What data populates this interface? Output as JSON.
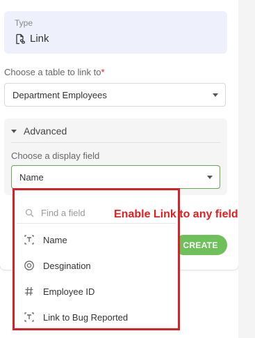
{
  "type_field": {
    "label": "Type",
    "value": "Link",
    "icon": "link-file-icon"
  },
  "table_field": {
    "label": "Choose a table to link to",
    "required_mark": "*",
    "value": "Department Employees"
  },
  "advanced": {
    "label": "Advanced",
    "display_field_label": "Choose a display field",
    "display_field_value": "Name"
  },
  "dropdown": {
    "search_placeholder": "Find a field",
    "options": [
      {
        "label": "Name",
        "icon": "text-field-icon"
      },
      {
        "label": "Desgination",
        "icon": "single-select-icon"
      },
      {
        "label": "Employee ID",
        "icon": "number-field-icon"
      },
      {
        "label": "Link to Bug Reported",
        "icon": "text-field-icon"
      }
    ]
  },
  "create_button": {
    "label": "CREATE"
  },
  "annotation": {
    "text": "Enable Link to any field"
  },
  "colors": {
    "type_box_bg": "#eef0fb",
    "create_button": "#6dc05a",
    "focus_border": "#6aa84f",
    "annotation_red": "#dc1f26"
  }
}
